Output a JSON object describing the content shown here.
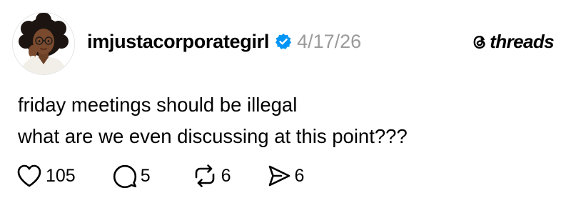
{
  "post": {
    "author": {
      "username": "imjustacorporategirl",
      "verified": true,
      "verified_color": "#0095f6"
    },
    "timestamp": "4/17/26",
    "brand": {
      "name": "threads",
      "icon": "threads-logo-icon"
    },
    "text_lines": [
      "friday meetings should be illegal",
      "what are we even discussing at this point???"
    ],
    "actions": {
      "like": {
        "icon": "heart-icon",
        "count": "105"
      },
      "reply": {
        "icon": "comment-icon",
        "count": "5"
      },
      "repost": {
        "icon": "repost-icon",
        "count": "6"
      },
      "share": {
        "icon": "send-icon",
        "count": "6"
      }
    }
  },
  "colors": {
    "text": "#000000",
    "muted": "#9a9a9a",
    "background": "#ffffff",
    "verified": "#0095f6"
  }
}
